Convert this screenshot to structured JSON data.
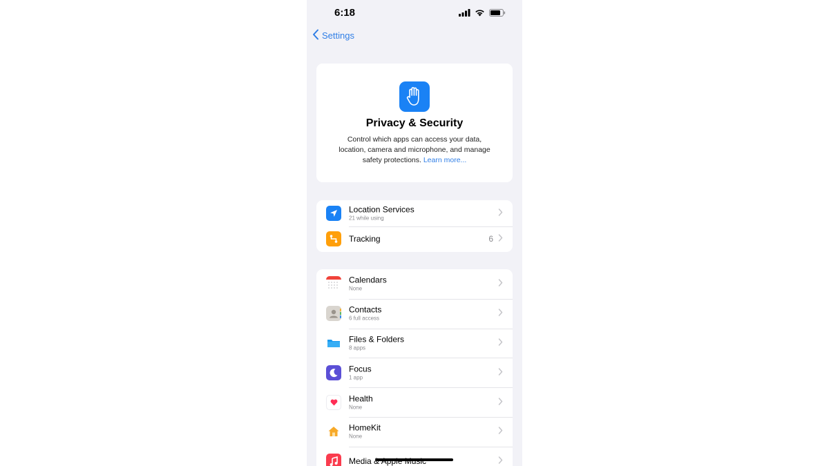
{
  "status_bar": {
    "time": "6:18"
  },
  "nav": {
    "back_label": "Settings"
  },
  "header": {
    "title": "Privacy & Security",
    "description": "Control which apps can access your data, location, camera and microphone, and manage safety protections.",
    "learn_more": "Learn more..."
  },
  "groups": [
    {
      "items": [
        {
          "title": "Location Services",
          "subtitle": "21 while using",
          "icon": "location-arrow-icon",
          "color": "#1a82f5"
        },
        {
          "title": "Tracking",
          "count": "6",
          "icon": "tracking-icon",
          "color": "#ff9f0a"
        }
      ]
    },
    {
      "items": [
        {
          "title": "Calendars",
          "subtitle": "None",
          "icon": "calendar-icon"
        },
        {
          "title": "Contacts",
          "subtitle": "6 full access",
          "icon": "contacts-icon"
        },
        {
          "title": "Files & Folders",
          "subtitle": "8 apps",
          "icon": "folder-icon",
          "color": "#1a9af0"
        },
        {
          "title": "Focus",
          "subtitle": "1 app",
          "icon": "moon-icon",
          "color": "#5b4fd6"
        },
        {
          "title": "Health",
          "subtitle": "None",
          "icon": "heart-icon",
          "color": "#ff2d55"
        },
        {
          "title": "HomeKit",
          "subtitle": "None",
          "icon": "home-icon",
          "color": "#f7a928"
        },
        {
          "title": "Media & Apple Music",
          "subtitle": "",
          "icon": "music-icon",
          "color": "#fa3c4e"
        }
      ]
    }
  ]
}
